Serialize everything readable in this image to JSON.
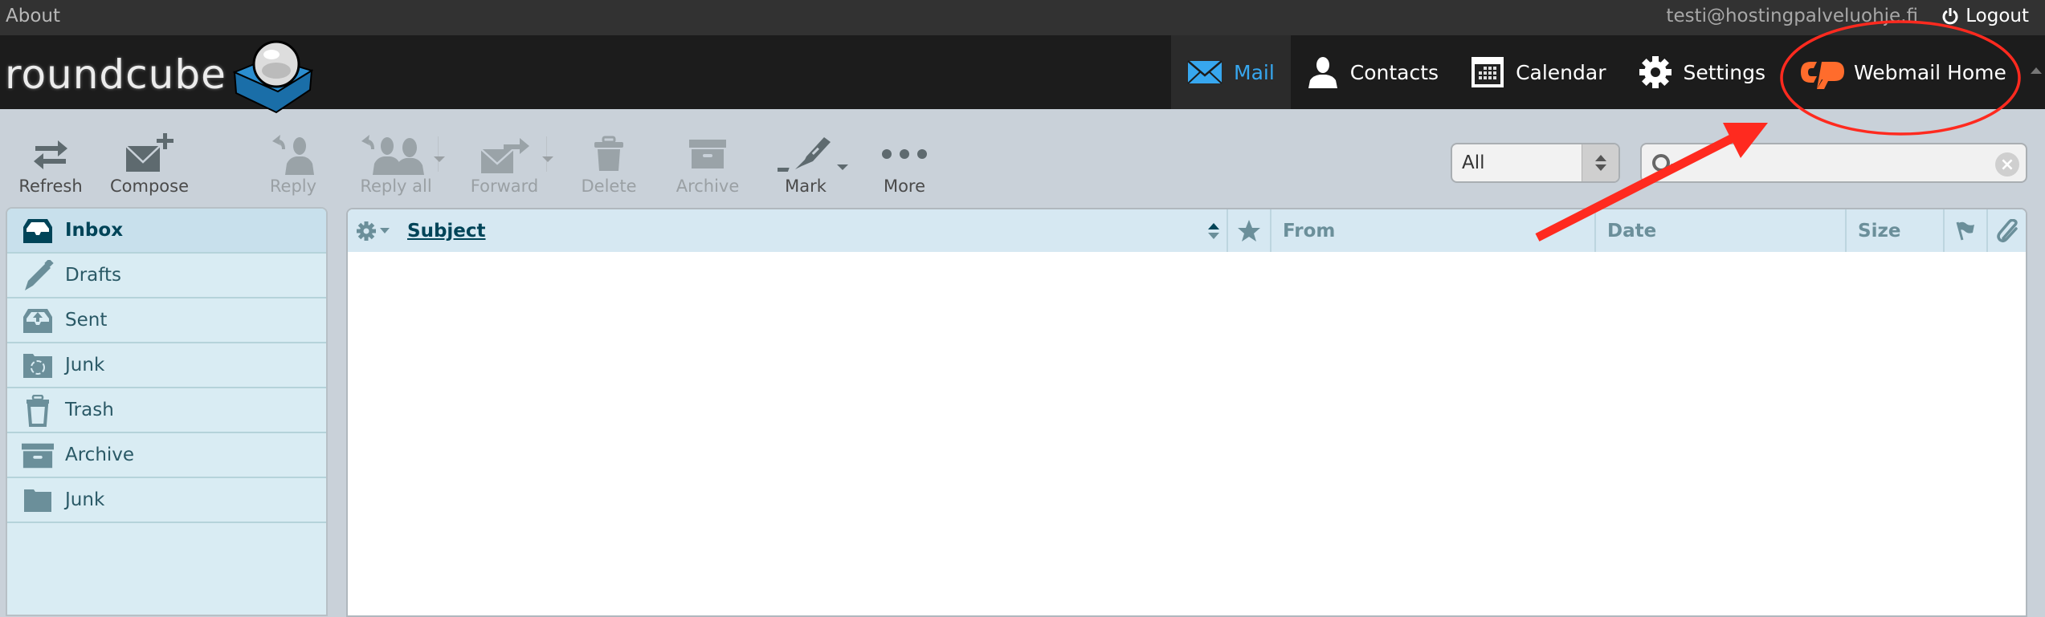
{
  "topbar": {
    "about_label": "About",
    "user_email": "testi@hostingpalveluohje.fi",
    "logout_label": "Logout"
  },
  "header": {
    "logo_text": "roundcube",
    "tasks": [
      {
        "label": "Mail",
        "icon": "mail-icon",
        "active": true
      },
      {
        "label": "Contacts",
        "icon": "contacts-icon",
        "active": false
      },
      {
        "label": "Calendar",
        "icon": "calendar-icon",
        "active": false
      },
      {
        "label": "Settings",
        "icon": "gear-icon",
        "active": false
      },
      {
        "label": "Webmail Home",
        "icon": "cpanel-icon",
        "active": false
      }
    ],
    "active_color": "#37a7ef",
    "cpanel_color": "#ff6c2c"
  },
  "toolbar": {
    "buttons": [
      {
        "label": "Refresh",
        "icon": "refresh-icon",
        "enabled": true
      },
      {
        "label": "Compose",
        "icon": "compose-icon",
        "enabled": true
      },
      {
        "label": "Reply",
        "icon": "reply-icon",
        "enabled": false
      },
      {
        "label": "Reply all",
        "icon": "reply-all-icon",
        "enabled": false,
        "dropdown": true
      },
      {
        "label": "Forward",
        "icon": "forward-icon",
        "enabled": false,
        "dropdown": true
      },
      {
        "label": "Delete",
        "icon": "trash-icon",
        "enabled": false
      },
      {
        "label": "Archive",
        "icon": "archive-icon",
        "enabled": false
      },
      {
        "label": "Mark",
        "icon": "mark-icon",
        "enabled": true,
        "dropdown": true
      },
      {
        "label": "More",
        "icon": "more-icon",
        "enabled": true
      }
    ],
    "filter": {
      "selected": "All"
    },
    "search": {
      "value": "",
      "placeholder": ""
    }
  },
  "folders": [
    {
      "label": "Inbox",
      "icon": "inbox-icon",
      "selected": true
    },
    {
      "label": "Drafts",
      "icon": "pencil-icon",
      "selected": false
    },
    {
      "label": "Sent",
      "icon": "sent-icon",
      "selected": false
    },
    {
      "label": "Junk",
      "icon": "junk-icon",
      "selected": false
    },
    {
      "label": "Trash",
      "icon": "trash-icon",
      "selected": false
    },
    {
      "label": "Archive",
      "icon": "archive-icon",
      "selected": false
    },
    {
      "label": "Junk",
      "icon": "folder-icon",
      "selected": false
    }
  ],
  "message_list": {
    "columns": {
      "subject": "Subject",
      "from": "From",
      "date": "Date",
      "size": "Size"
    },
    "rows": []
  },
  "annotation": {
    "color": "#ff2a1f",
    "target": "Webmail Home"
  }
}
